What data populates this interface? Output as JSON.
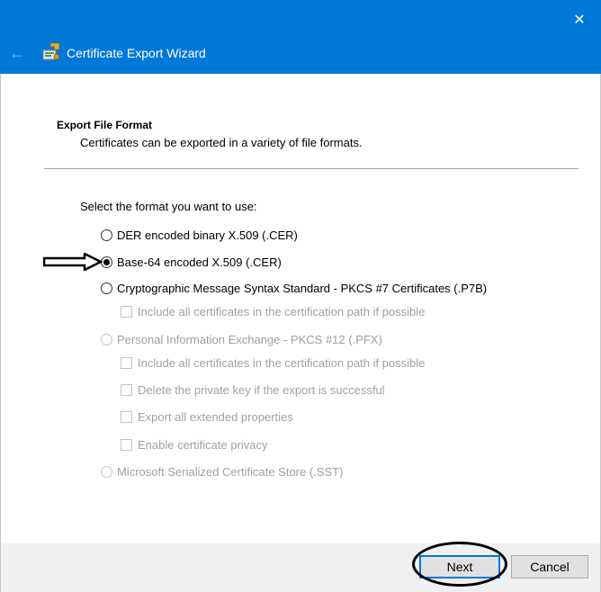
{
  "window": {
    "title": "Certificate Export Wizard",
    "close_glyph": "✕",
    "back_glyph": "←",
    "accent_color": "#0078d7"
  },
  "header": {
    "title": "Export File Format",
    "subtitle": "Certificates can be exported in a variety of file formats."
  },
  "prompt": "Select the format you want to use:",
  "options": {
    "der": {
      "label": "DER encoded binary X.509 (.CER)",
      "checked": false,
      "enabled": true
    },
    "base64": {
      "label": "Base-64 encoded X.509 (.CER)",
      "checked": true,
      "enabled": true
    },
    "pkcs7": {
      "label": "Cryptographic Message Syntax Standard - PKCS #7 Certificates (.P7B)",
      "checked": false,
      "enabled": true
    },
    "pkcs7_include": {
      "label": "Include all certificates in the certification path if possible",
      "checked": false,
      "enabled": false
    },
    "pfx": {
      "label": "Personal Information Exchange - PKCS #12 (.PFX)",
      "checked": false,
      "enabled": false
    },
    "pfx_include": {
      "label": "Include all certificates in the certification path if possible",
      "checked": false,
      "enabled": false
    },
    "pfx_delete_key": {
      "label": "Delete the private key if the export is successful",
      "checked": false,
      "enabled": false
    },
    "pfx_export_props": {
      "label": "Export all extended properties",
      "checked": false,
      "enabled": false
    },
    "pfx_privacy": {
      "label": "Enable certificate privacy",
      "checked": false,
      "enabled": false
    },
    "sst": {
      "label": "Microsoft Serialized Certificate Store (.SST)",
      "checked": false,
      "enabled": false
    }
  },
  "buttons": {
    "next": "Next",
    "cancel": "Cancel"
  }
}
